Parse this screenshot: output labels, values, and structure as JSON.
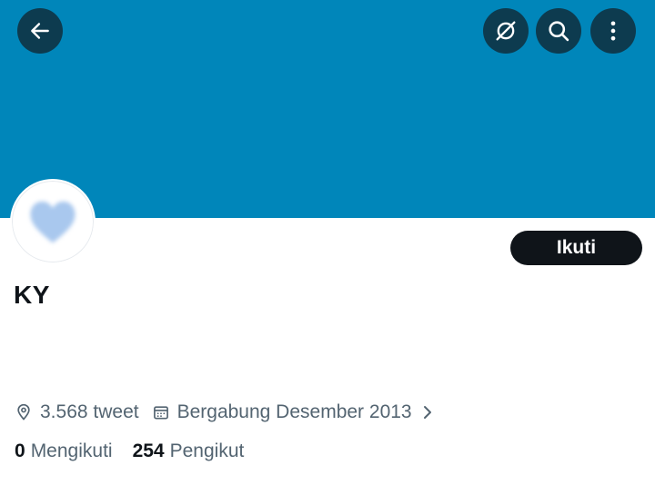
{
  "header": {
    "back_icon": "arrow-left-icon",
    "hide_icon": "eye-slash-circle-icon",
    "search_icon": "search-icon",
    "more_icon": "more-vertical-icon",
    "banner_color": "#0086ba",
    "button_color": "#0d3b4f"
  },
  "profile": {
    "avatar_icon": "heart-icon",
    "avatar_color": "#a9c8ee",
    "follow_label": "Ikuti",
    "display_name": "KY",
    "tweets": "3.568 tweet",
    "joined": "Bergabung Desember 2013",
    "following_count": "0",
    "following_label": "Mengikuti",
    "followers_count": "254",
    "followers_label": "Pengikut"
  }
}
